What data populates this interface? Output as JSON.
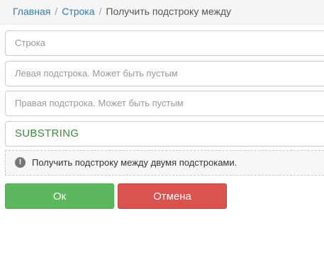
{
  "breadcrumb": {
    "home": "Главная",
    "section": "Строка",
    "current": "Получить подстроку между",
    "separator": "/"
  },
  "form": {
    "string_placeholder": "Строка",
    "left_placeholder": "Левая подстрока. Может быть пустым",
    "right_placeholder": "Правая подстрока. Может быть пустым",
    "result_value": "SUBSTRING"
  },
  "info": {
    "icon": "!",
    "text": "Получить подстроку между двумя подстроками."
  },
  "buttons": {
    "ok": "Ок",
    "cancel": "Отмена"
  },
  "colors": {
    "link": "#337ab7",
    "ok": "#5cb85c",
    "cancel": "#d9534f",
    "result_text": "#3c8a3c"
  }
}
